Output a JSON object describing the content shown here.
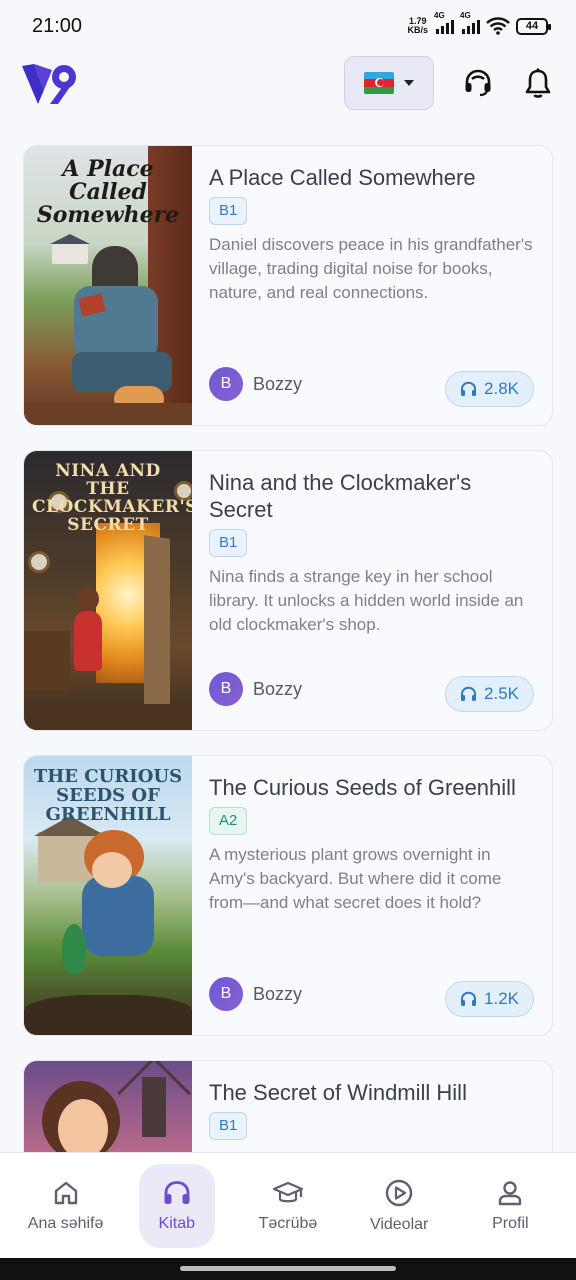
{
  "status_bar": {
    "time": "21:00",
    "net_speed_value": "1.79",
    "net_speed_unit": "KB/s",
    "network_type_1": "4G",
    "network_type_2": "4G",
    "battery": "44"
  },
  "header": {
    "logo_icon": "app-logo",
    "language_flag": "azerbaijan-flag-icon",
    "support_icon": "headset-support-icon",
    "notifications_icon": "bell-icon"
  },
  "books": [
    {
      "title": "A Place Called Somewhere",
      "cover_title": "A Place Called Somewhere",
      "level": "B1",
      "description": "Daniel discovers peace in his grandfather's village, trading digital noise for books, nature, and real connections.",
      "author_initial": "B",
      "author": "Bozzy",
      "listens": "2.8K"
    },
    {
      "title": "Nina and the Clockmaker's Secret",
      "cover_title": "NINA AND THE CLOCKMAKER'S SECRET",
      "level": "B1",
      "description": "Nina finds a strange key in her school library. It unlocks a hidden world inside an old clockmaker's shop.",
      "author_initial": "B",
      "author": "Bozzy",
      "listens": "2.5K"
    },
    {
      "title": "The Curious Seeds of Greenhill",
      "cover_title": "THE CURIOUS SEEDS OF GREENHILL",
      "level": "A2",
      "description": "A mysterious plant grows overnight in Amy's backyard. But where did it come from—and what secret does it hold?",
      "author_initial": "B",
      "author": "Bozzy",
      "listens": "1.2K"
    },
    {
      "title": "The Secret of Windmill Hill",
      "level": "B1"
    }
  ],
  "nav": {
    "items": [
      {
        "label": "Ana səhifə",
        "icon": "home-icon"
      },
      {
        "label": "Kitab",
        "icon": "headphones-icon"
      },
      {
        "label": "Təcrübə",
        "icon": "graduation-cap-icon"
      },
      {
        "label": "Videolar",
        "icon": "play-circle-icon"
      },
      {
        "label": "Profil",
        "icon": "user-icon"
      }
    ],
    "active": "Kitab"
  },
  "colors": {
    "accent": "#6a4fcf",
    "background": "#f7f8fc",
    "badge_b1": "#2d7bcf",
    "badge_a2": "#23906f"
  }
}
